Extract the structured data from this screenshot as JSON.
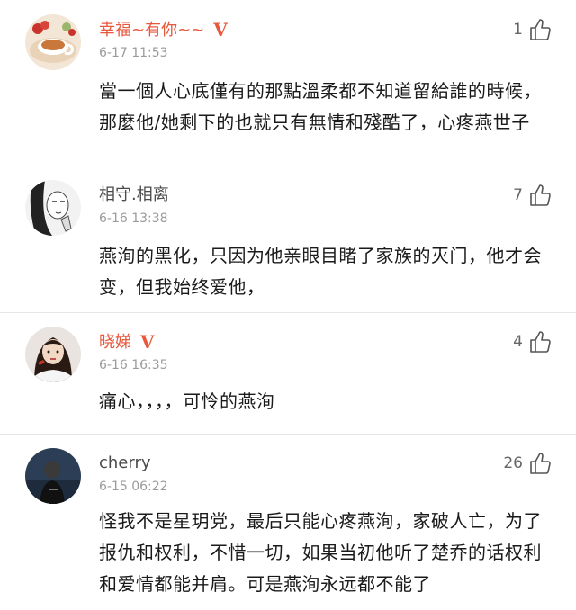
{
  "comments": [
    {
      "name": "幸福~有你~~",
      "verified": true,
      "verified_mark": "V",
      "time": "6-17 11:53",
      "likes": "1",
      "text": "當一個人心底僅有的那點溫柔都不知道留給誰的時候，那麼他/她剩下的也就只有無情和殘酷了，心疼燕世子",
      "avatar_icon": "tea-cup-avatar"
    },
    {
      "name": "相守.相离",
      "verified": false,
      "time": "6-16 13:38",
      "likes": "7",
      "text": "燕洵的黑化，只因为他亲眼目睹了家族的灭门，他才会变，但我始终爱他，",
      "avatar_icon": "sketch-girl-avatar"
    },
    {
      "name": "晓娣",
      "verified": true,
      "verified_mark": "V",
      "time": "6-16 16:35",
      "likes": "4",
      "text": "痛心，，，，可怜的燕洵",
      "avatar_icon": "girl-portrait-avatar"
    },
    {
      "name": "cherry",
      "verified": false,
      "time": "6-15 06:22",
      "likes": "26",
      "text": "怪我不是星玥党，最后只能心疼燕洵，家破人亡，为了报仇和权利，不惜一切，如果当初他听了楚乔的话权利和爱情都能并肩。可是燕洵永远都不能了",
      "avatar_icon": "dark-photo-avatar"
    }
  ],
  "colors": {
    "vip_name": "#e8583d",
    "name": "#4a4a4a",
    "time": "#9b9b9b",
    "text": "#1a1a1a",
    "divider": "#e6e6e6"
  }
}
